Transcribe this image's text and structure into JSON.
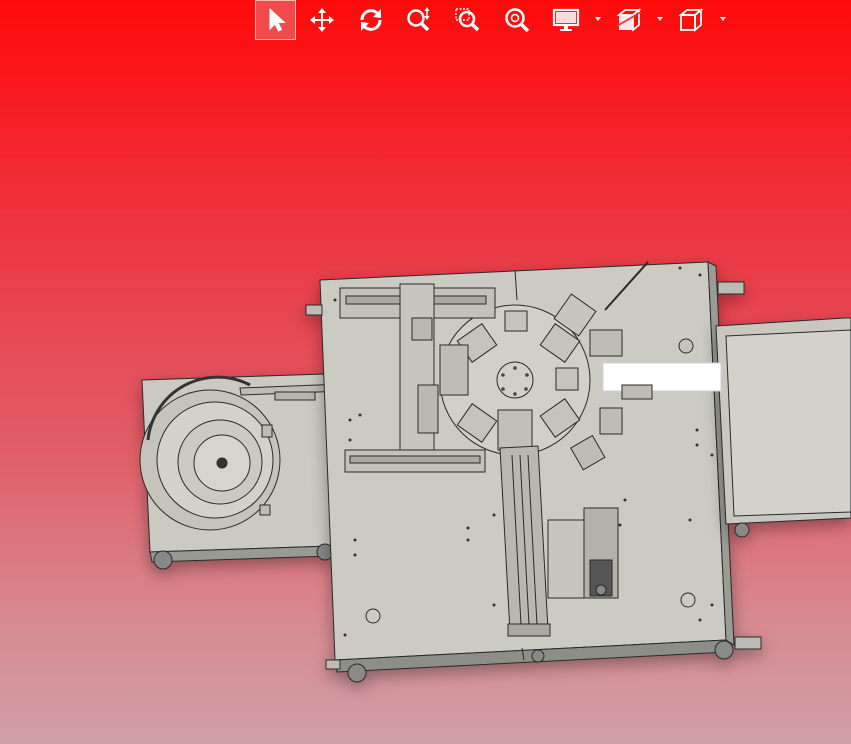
{
  "toolbar": {
    "buttons": [
      {
        "name": "select-tool-button",
        "icon": "arrow-pointer-icon",
        "active": true
      },
      {
        "name": "pan-tool-button",
        "icon": "move-arrows-icon",
        "active": false
      },
      {
        "name": "rotate-tool-button",
        "icon": "rotate-icon",
        "active": false
      },
      {
        "name": "zoom-tool-button",
        "icon": "zoom-updown-icon",
        "active": false
      },
      {
        "name": "zoom-window-button",
        "icon": "zoom-window-icon",
        "active": false
      },
      {
        "name": "zoom-fit-button",
        "icon": "zoom-fit-icon",
        "active": false
      },
      {
        "name": "display-mode-button",
        "icon": "monitor-icon",
        "active": false,
        "dropdown": true
      },
      {
        "name": "section-view-button",
        "icon": "section-cube-icon",
        "active": false,
        "dropdown": true
      },
      {
        "name": "view-orientation-button",
        "icon": "cube-icon",
        "active": false,
        "dropdown": true
      }
    ]
  },
  "viewport": {
    "background_top": "#ff0a0a",
    "background_bottom": "#cfa0a6",
    "model_color": "#cfcfc8",
    "edge_color": "#2a2a2a"
  }
}
